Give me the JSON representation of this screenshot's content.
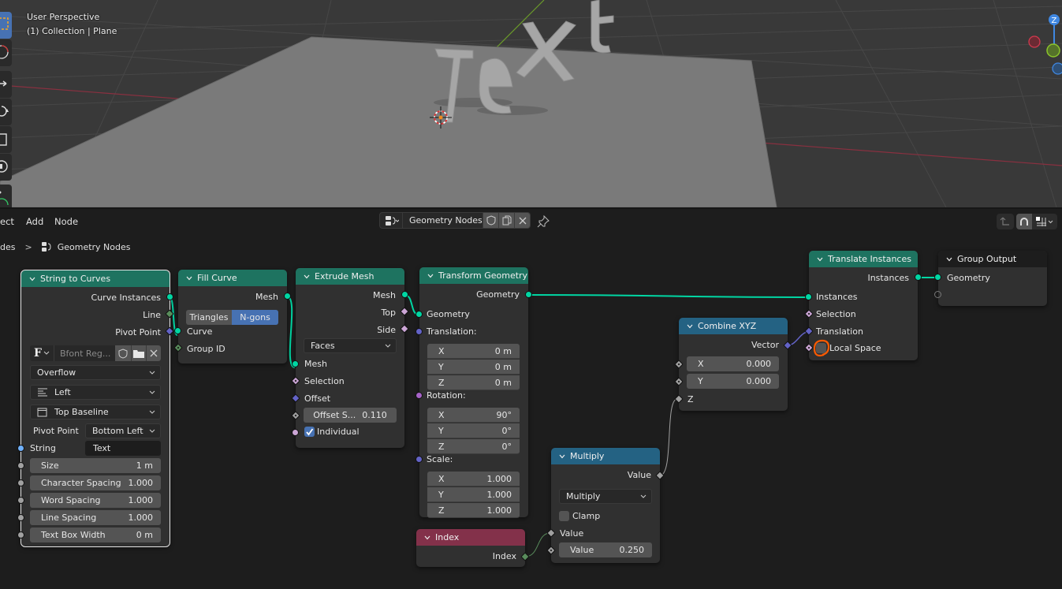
{
  "viewport": {
    "view_name": "User Perspective",
    "collection_line": "(1) Collection | Plane",
    "scene_text": "Text",
    "gizmo": {
      "z_label": "Z",
      "x_color": "#d2394e",
      "y_color": "#8bc42a",
      "z_color": "#3f87e1"
    },
    "tools": [
      "select-box",
      "cursor",
      "move",
      "rotate",
      "scale",
      "transform",
      "annotate"
    ]
  },
  "header": {
    "menus": [
      "ect",
      "Add",
      "Node"
    ],
    "node_tree_name": "Geometry Nodes",
    "breadcrumb_prefix": "des",
    "breadcrumb_separator": ">",
    "breadcrumb_item": "Geometry Nodes"
  },
  "colors": {
    "geometry_socket": "#00d6a3",
    "vector_socket": "#6363c7",
    "boolean_socket": "#cca6d6",
    "int_socket": "#598c5c",
    "float_socket": "#a1a1a1",
    "string_socket": "#70b2ff",
    "rotation_socket": "#a663c7",
    "geometry_header": "#1e7360",
    "converter_header": "#246283",
    "input_header": "#83314a",
    "accent": "#4772b3",
    "annotation": "#ff5a00"
  },
  "nodes": {
    "string_to_curves": {
      "title": "String to Curves",
      "outputs": [
        "Curve Instances",
        "Line",
        "Pivot Point"
      ],
      "font_name": "Bfont Reg...",
      "overflow": "Overflow",
      "align_x": "Left",
      "align_y": "Top Baseline",
      "pivot_label": "Pivot Point",
      "pivot_value": "Bottom Left",
      "string_label": "String",
      "string_value": "Text",
      "fields": [
        {
          "label": "Size",
          "value": "1 m"
        },
        {
          "label": "Character Spacing",
          "value": "1.000"
        },
        {
          "label": "Word Spacing",
          "value": "1.000"
        },
        {
          "label": "Line Spacing",
          "value": "1.000"
        },
        {
          "label": "Text Box Width",
          "value": "0 m"
        }
      ]
    },
    "fill_curve": {
      "title": "Fill Curve",
      "output": "Mesh",
      "mode_options": [
        "Triangles",
        "N-gons"
      ],
      "mode_selected": "N-gons",
      "inputs": [
        "Curve",
        "Group ID"
      ]
    },
    "extrude_mesh": {
      "title": "Extrude Mesh",
      "outputs": [
        "Mesh",
        "Top",
        "Side"
      ],
      "mode": "Faces",
      "inputs": [
        "Mesh",
        "Selection",
        "Offset"
      ],
      "offset_scale_label": "Offset S...",
      "offset_scale_value": "0.110",
      "individual_label": "Individual",
      "individual_checked": true
    },
    "transform_geometry": {
      "title": "Transform Geometry",
      "output": "Geometry",
      "input_geometry": "Geometry",
      "translation_label": "Translation:",
      "translation": [
        {
          "axis": "X",
          "value": "0 m"
        },
        {
          "axis": "Y",
          "value": "0 m"
        },
        {
          "axis": "Z",
          "value": "0 m"
        }
      ],
      "rotation_label": "Rotation:",
      "rotation": [
        {
          "axis": "X",
          "value": "90°"
        },
        {
          "axis": "Y",
          "value": "0°"
        },
        {
          "axis": "Z",
          "value": "0°"
        }
      ],
      "scale_label": "Scale:",
      "scale": [
        {
          "axis": "X",
          "value": "1.000"
        },
        {
          "axis": "Y",
          "value": "1.000"
        },
        {
          "axis": "Z",
          "value": "1.000"
        }
      ]
    },
    "index": {
      "title": "Index",
      "output": "Index"
    },
    "multiply": {
      "title": "Multiply",
      "output": "Value",
      "operation": "Multiply",
      "clamp_label": "Clamp",
      "clamp_checked": false,
      "input_value_label": "Value",
      "field_label": "Value",
      "field_value": "0.250"
    },
    "combine_xyz": {
      "title": "Combine XYZ",
      "output": "Vector",
      "x_label": "X",
      "x_value": "0.000",
      "y_label": "Y",
      "y_value": "0.000",
      "z_label": "Z"
    },
    "translate_instances": {
      "title": "Translate Instances",
      "output": "Instances",
      "inputs": [
        "Instances",
        "Selection",
        "Translation"
      ],
      "local_space_label": "Local Space",
      "local_space_checked": false
    },
    "group_output": {
      "title": "Group Output",
      "input": "Geometry"
    }
  }
}
